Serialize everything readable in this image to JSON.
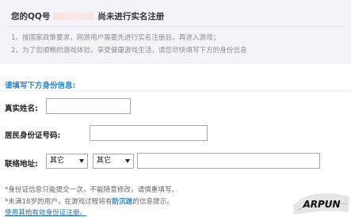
{
  "banner": {
    "title_prefix": "您的QQ号",
    "title_suffix": "尚未进行实名注册",
    "notice_1": "1、按国家政策要求，网游用户需要先进行实名注册后，再进入游戏；",
    "notice_2": "2、为了您顺畅的游戏体验，享受健康游戏生活，请您尽快填写下方的身份信息"
  },
  "form": {
    "section_title": "请填写下方身份信息:",
    "name_label": "真实姓名:",
    "name_value": "",
    "id_label": "居民身份证号码:",
    "id_value": "",
    "address_label": "联络地址:",
    "province_selected": "其它",
    "city_selected": "其它",
    "address_value": ""
  },
  "footer": {
    "note_1": "*身份证信息只能提交一次，不能随意修改，请慎重填写。",
    "note_2_prefix": "*未满18岁的用户，在游戏过程将有",
    "note_2_highlight": "防沉迷",
    "note_2_suffix": "的信息提示。",
    "link": "使用其他有效身份证注册。"
  },
  "watermark": {
    "text": "ARPUN"
  },
  "colors": {
    "banner_bg": "#f3f4f8",
    "section_title": "#2c86c9",
    "link": "#1f6fb8",
    "highlight": "#2a7fc7"
  }
}
